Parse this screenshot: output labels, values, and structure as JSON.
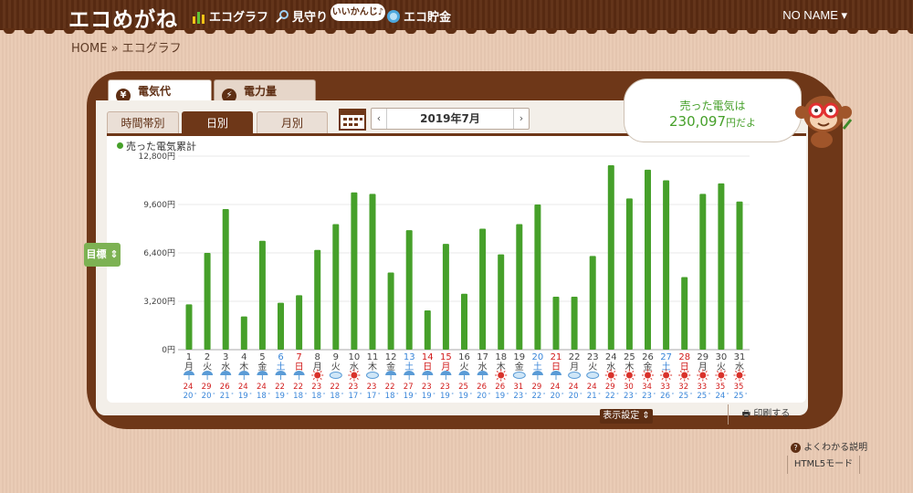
{
  "app": {
    "logo": "エコめがね",
    "user": "NO NAME ▾"
  },
  "nav": [
    {
      "label": "エコグラフ",
      "icon": "bar-graph-icon"
    },
    {
      "label": "見守り",
      "icon": "magnifier-icon"
    },
    {
      "label": "エコ貯金",
      "icon": "coin-icon"
    }
  ],
  "nav_bubble": "いいかんじ♪",
  "breadcrumb": "HOME » エコグラフ",
  "tabs": [
    {
      "label": "電気代",
      "icon_glyph": "¥"
    },
    {
      "label": "電力量",
      "icon_glyph": "⚡"
    }
  ],
  "subtabs": [
    "時間帯別",
    "日別",
    "月別"
  ],
  "date": {
    "prev": "‹",
    "label": "2019年7月",
    "next": "›"
  },
  "sold": {
    "line1": "売った電気は",
    "amount": "230,097",
    "unit": "円だよ"
  },
  "target_button": "目標 ⇕",
  "colors": {
    "bar": "#46a02a",
    "sunday": "#d11a1a",
    "saturday": "#3a86d9",
    "brown": "#6e3718"
  },
  "footer": {
    "display_settings": "表示設定 ⇕",
    "print": "印刷する",
    "help": "よくわかる説明",
    "html5": "HTML5モード"
  },
  "chart_data": {
    "type": "bar",
    "series": [
      {
        "name": "売った電気累計",
        "values": [
          3000,
          6400,
          9300,
          2200,
          7200,
          3100,
          3600,
          6600,
          8300,
          10400,
          10300,
          5100,
          7900,
          2600,
          7000,
          3700,
          8000,
          6300,
          8300,
          9600,
          3500,
          3500,
          6200,
          12200,
          10000,
          11900,
          11200,
          4800,
          10300,
          11000,
          9800
        ]
      }
    ],
    "categories": [
      "1",
      "2",
      "3",
      "4",
      "5",
      "6",
      "7",
      "8",
      "9",
      "10",
      "11",
      "12",
      "13",
      "14",
      "15",
      "16",
      "17",
      "18",
      "19",
      "20",
      "21",
      "22",
      "23",
      "24",
      "25",
      "26",
      "27",
      "28",
      "29",
      "30",
      "31"
    ],
    "weekdays": [
      "月",
      "火",
      "水",
      "木",
      "金",
      "土",
      "日",
      "月",
      "火",
      "水",
      "木",
      "金",
      "土",
      "日",
      "月",
      "火",
      "水",
      "木",
      "金",
      "土",
      "日",
      "月",
      "火",
      "水",
      "木",
      "金",
      "土",
      "日",
      "月",
      "火",
      "水"
    ],
    "day_colors": [
      "n",
      "n",
      "n",
      "n",
      "n",
      "sat",
      "sun",
      "n",
      "n",
      "n",
      "n",
      "n",
      "sat",
      "sun",
      "sun",
      "n",
      "n",
      "n",
      "n",
      "sat",
      "sun",
      "n",
      "n",
      "n",
      "n",
      "n",
      "sat",
      "sun",
      "n",
      "n",
      "n"
    ],
    "weather": [
      "rain",
      "rain",
      "rain",
      "rain",
      "rain",
      "rain",
      "rain",
      "sun",
      "cloud",
      "sun",
      "cloud",
      "rain",
      "rain",
      "rain",
      "rain",
      "rain",
      "rain",
      "sun",
      "cloud",
      "rain",
      "rain",
      "cloud",
      "cloud",
      "sun",
      "sun",
      "sun",
      "sun",
      "sun",
      "sun",
      "sun",
      "sun"
    ],
    "temp_high": [
      24,
      29,
      26,
      24,
      24,
      22,
      22,
      23,
      22,
      23,
      23,
      22,
      27,
      23,
      23,
      25,
      26,
      26,
      31,
      29,
      24,
      24,
      24,
      29,
      30,
      34,
      33,
      32,
      33,
      35,
      35
    ],
    "temp_low": [
      20,
      20,
      21,
      19,
      18,
      19,
      18,
      18,
      18,
      17,
      17,
      18,
      19,
      19,
      19,
      19,
      20,
      19,
      23,
      22,
      20,
      20,
      21,
      22,
      23,
      23,
      26,
      25,
      25,
      24,
      25
    ],
    "yticks": [
      "0円",
      "3,200円",
      "6,400円",
      "9,600円",
      "12,800円"
    ],
    "ylim": [
      0,
      12800
    ],
    "grid": true,
    "legend": "top-left"
  }
}
